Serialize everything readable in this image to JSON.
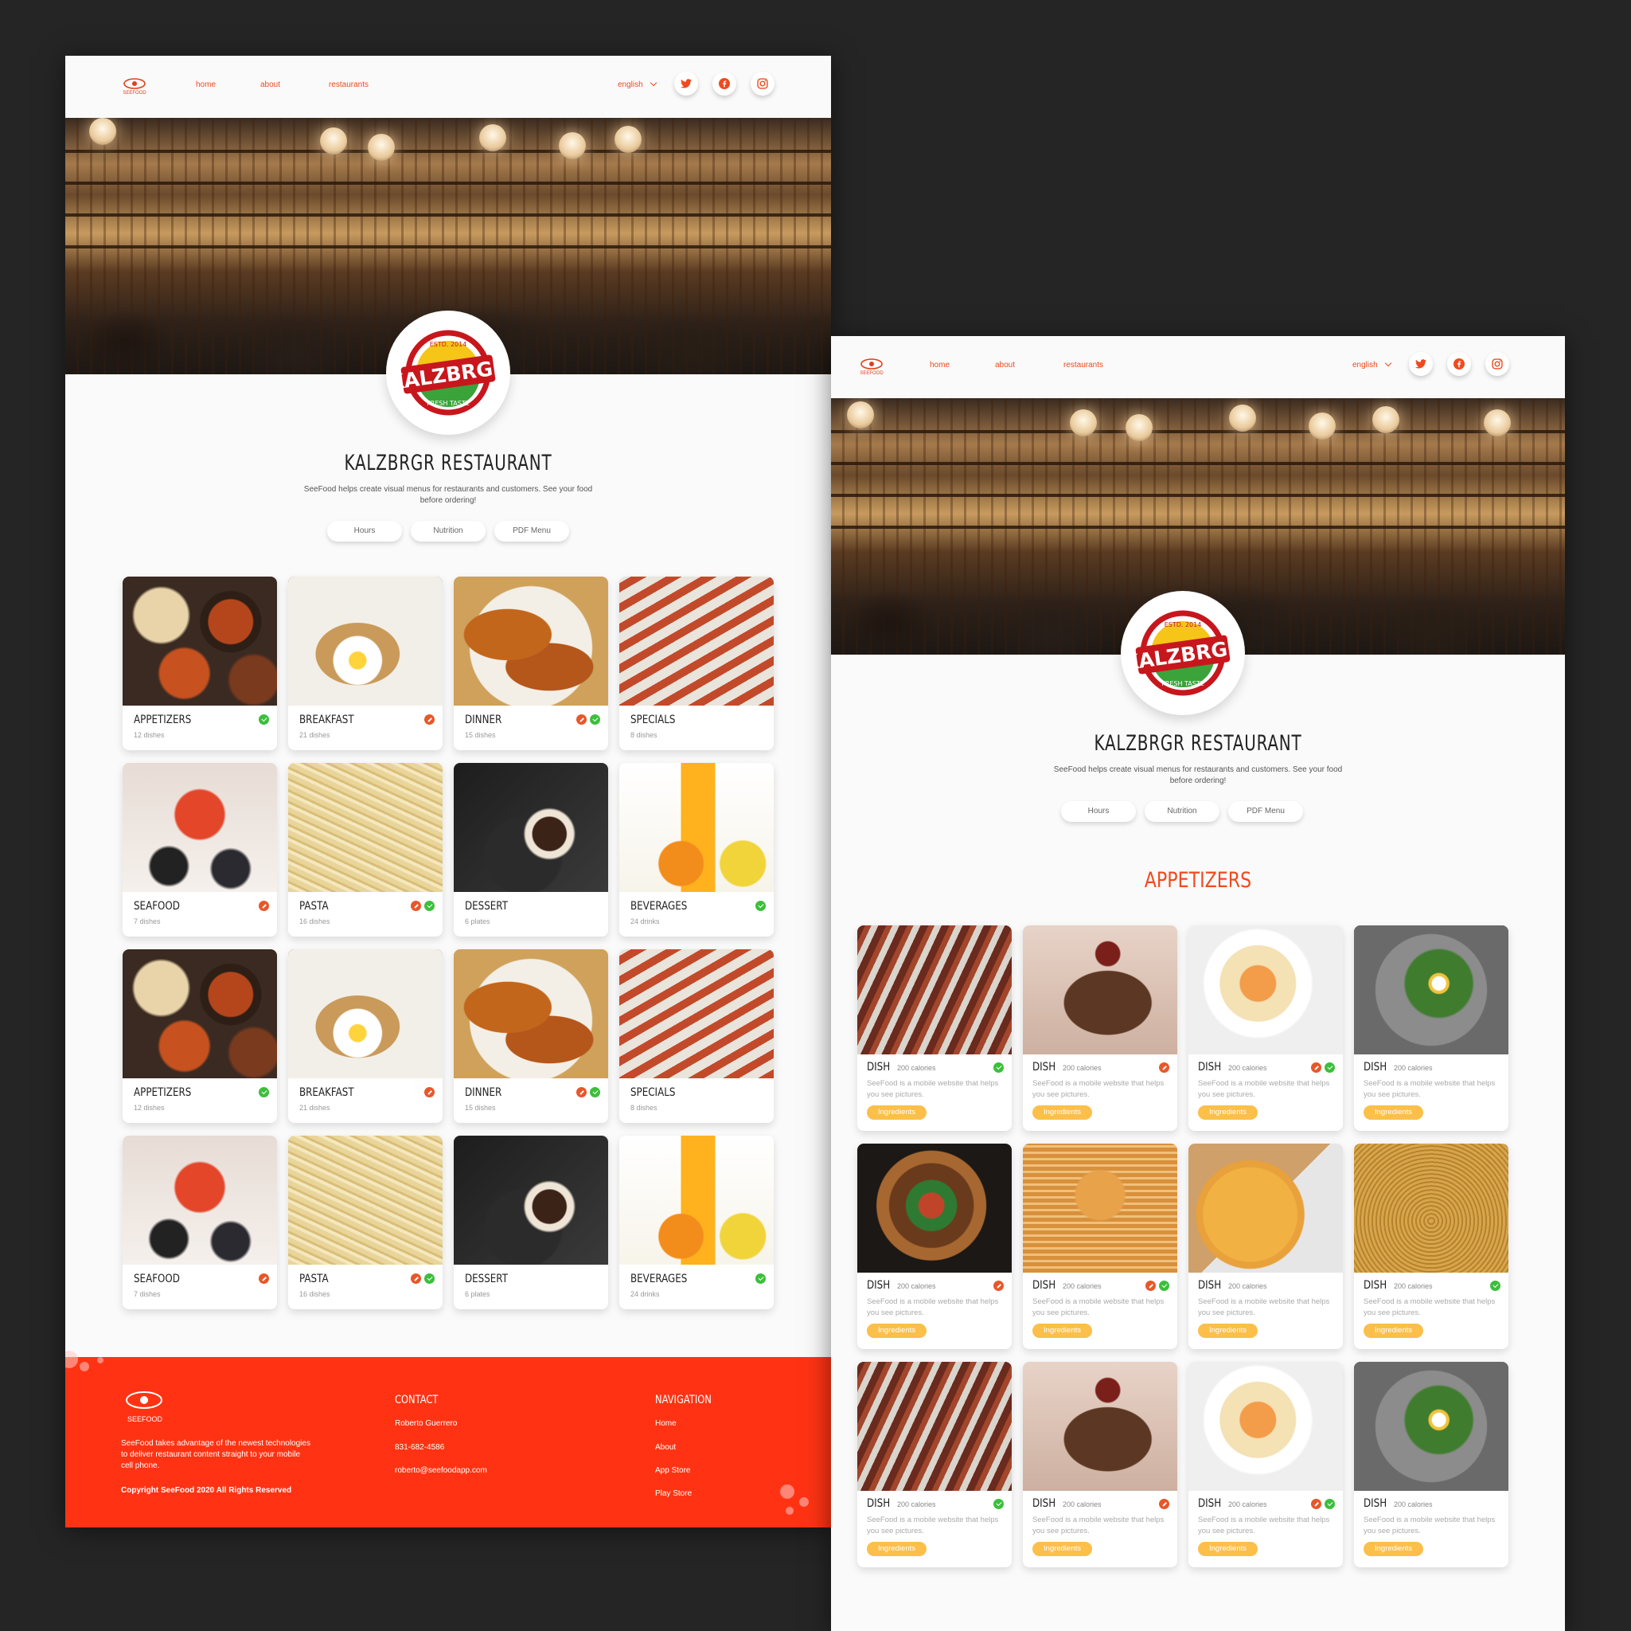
{
  "nav": {
    "logo_text": "SEEFOOD",
    "links": [
      "home",
      "about",
      "restaurants"
    ],
    "language": "english",
    "social": [
      "twitter-icon",
      "facebook-icon",
      "instagram-icon"
    ]
  },
  "restaurant": {
    "logo_top": "ESTD. 2014",
    "logo_name": "KALZBRGR",
    "logo_bottom": "FRESH TASTE",
    "title": "KALZBRGR RESTAURANT",
    "description": "SeeFood helps create visual menus for restaurants and customers.  See your food before ordering!",
    "buttons": [
      "Hours",
      "Nutrition",
      "PDF Menu"
    ]
  },
  "categories": [
    {
      "name": "APPETIZERS",
      "count": "12 dishes",
      "badges": [
        "green"
      ]
    },
    {
      "name": "BREAKFAST",
      "count": "21 dishes",
      "badges": [
        "orange"
      ]
    },
    {
      "name": "DINNER",
      "count": "15 dishes",
      "badges": [
        "orange",
        "green"
      ]
    },
    {
      "name": "SPECIALS",
      "count": "8 dishes",
      "badges": []
    },
    {
      "name": "SEAFOOD",
      "count": "7 dishes",
      "badges": [
        "orange"
      ]
    },
    {
      "name": "PASTA",
      "count": "16 dishes",
      "badges": [
        "orange",
        "green"
      ]
    },
    {
      "name": "DESSERT",
      "count": "6 plates",
      "badges": []
    },
    {
      "name": "BEVERAGES",
      "count": "24 drinks",
      "badges": [
        "green"
      ]
    },
    {
      "name": "APPETIZERS",
      "count": "12 dishes",
      "badges": [
        "green"
      ]
    },
    {
      "name": "BREAKFAST",
      "count": "21 dishes",
      "badges": [
        "orange"
      ]
    },
    {
      "name": "DINNER",
      "count": "15 dishes",
      "badges": [
        "orange",
        "green"
      ]
    },
    {
      "name": "SPECIALS",
      "count": "8 dishes",
      "badges": []
    },
    {
      "name": "SEAFOOD",
      "count": "7 dishes",
      "badges": [
        "orange"
      ]
    },
    {
      "name": "PASTA",
      "count": "16 dishes",
      "badges": [
        "orange",
        "green"
      ]
    },
    {
      "name": "DESSERT",
      "count": "6 plates",
      "badges": []
    },
    {
      "name": "BEVERAGES",
      "count": "24 drinks",
      "badges": [
        "green"
      ]
    }
  ],
  "section_title": "APPETIZERS",
  "dishes": [
    {
      "name": "DISH",
      "calories": "200 calories",
      "desc": "SeeFood is a mobile website that helps you see pictures.",
      "button": "Ingredients",
      "badges": [
        "green"
      ]
    },
    {
      "name": "DISH",
      "calories": "200 calories",
      "desc": "SeeFood is a mobile website that helps you see pictures.",
      "button": "Ingredients",
      "badges": [
        "orange"
      ]
    },
    {
      "name": "DISH",
      "calories": "200 calories",
      "desc": "SeeFood is a mobile website that helps you see pictures.",
      "button": "Ingredients",
      "badges": [
        "orange",
        "green"
      ]
    },
    {
      "name": "DISH",
      "calories": "200 calories",
      "desc": "SeeFood is a mobile website that helps you see pictures.",
      "button": "Ingredients",
      "badges": []
    },
    {
      "name": "DISH",
      "calories": "200 calories",
      "desc": "SeeFood is a mobile website that helps you see pictures.",
      "button": "Ingredients",
      "badges": [
        "orange"
      ]
    },
    {
      "name": "DISH",
      "calories": "200 calories",
      "desc": "SeeFood is a mobile website that helps you see pictures.",
      "button": "Ingredients",
      "badges": [
        "orange",
        "green"
      ]
    },
    {
      "name": "DISH",
      "calories": "200 calories",
      "desc": "SeeFood is a mobile website that helps you see pictures.",
      "button": "Ingredients",
      "badges": []
    },
    {
      "name": "DISH",
      "calories": "200 calories",
      "desc": "SeeFood is a mobile website that helps you see pictures.",
      "button": "Ingredients",
      "badges": [
        "green"
      ]
    },
    {
      "name": "DISH",
      "calories": "200 calories",
      "desc": "SeeFood is a mobile website that helps you see pictures.",
      "button": "Ingredients",
      "badges": [
        "green"
      ]
    },
    {
      "name": "DISH",
      "calories": "200 calories",
      "desc": "SeeFood is a mobile website that helps you see pictures.",
      "button": "Ingredients",
      "badges": [
        "orange"
      ]
    },
    {
      "name": "DISH",
      "calories": "200 calories",
      "desc": "SeeFood is a mobile website that helps you see pictures.",
      "button": "Ingredients",
      "badges": [
        "orange",
        "green"
      ]
    },
    {
      "name": "DISH",
      "calories": "200 calories",
      "desc": "SeeFood is a mobile website that helps you see pictures.",
      "button": "Ingredients",
      "badges": []
    }
  ],
  "footer": {
    "logo_text": "SEEFOOD",
    "about": "SeeFood takes advantage of the newest technologies to deliver restaurant content straight to your mobile cell phone.",
    "copyright": "Copyright SeeFood 2020 All Rights Reserved",
    "contact_title": "CONTACT",
    "contact": [
      "Roberto Guerrero",
      "831-682-4586",
      "roberto@seefoodapp.com"
    ],
    "nav_title": "NAVIGATION",
    "nav": [
      "Home",
      "About",
      "App Store",
      "Play Store"
    ]
  },
  "colors": {
    "accent": "#ef4a1e",
    "footer": "#ff3313",
    "ingredients": "#fbbf4a",
    "green": "#3cbf3c"
  }
}
